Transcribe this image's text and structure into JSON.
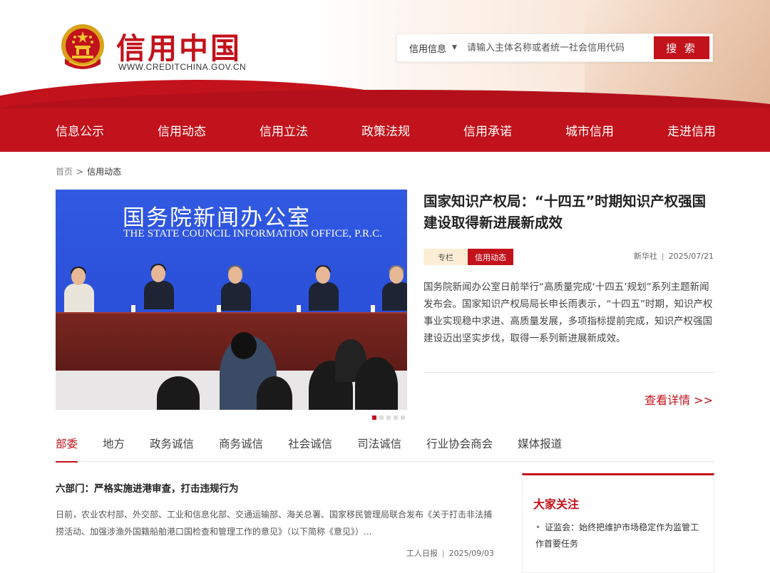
{
  "header": {
    "site_title": "信用中国",
    "site_url": "WWW.CREDITCHINA.GOV.CN",
    "brand_color": "#c2121b"
  },
  "search": {
    "category": "信用信息",
    "placeholder": "请输入主体名称或者统一社会信用代码",
    "button_label": "搜 索"
  },
  "nav": {
    "items": [
      "信息公示",
      "信用动态",
      "信用立法",
      "政策法规",
      "信用承诺",
      "城市信用",
      "走进信用"
    ]
  },
  "breadcrumb": {
    "home": "首页",
    "separator": ">",
    "current": "信用动态"
  },
  "feature": {
    "image": {
      "banner_cn": "国务院新闻办公室",
      "banner_en": "THE STATE COUNCIL INFORMATION OFFICE, P.R.C."
    },
    "title": "国家知识产权局：“十四五”时期知识产权强国建设取得新进展新成效",
    "tag_column": "专栏",
    "tag_category": "信用动态",
    "source": "新华社",
    "date": "2025/07/21",
    "summary": "国务院新闻办公室日前举行“高质量完成‘十四五’规划”系列主题新闻发布会。国家知识产权局局长申长雨表示，“十四五”时期，知识产权事业实现稳中求进、高质量发展，多项指标提前完成，知识产权强国建设迈出坚实步伐，取得一系列新进展新成效。",
    "more_label": "查看详情 >>",
    "carousel_count": 5,
    "carousel_active": 1
  },
  "tabs": {
    "items": [
      "部委",
      "地方",
      "政务诚信",
      "商务诚信",
      "社会诚信",
      "司法诚信",
      "行业协会商会",
      "媒体报道"
    ],
    "active": 0
  },
  "news": {
    "title": "六部门：严格实施进港审查，打击违规行为",
    "desc": "日前，农业农村部、外交部、工业和信息化部、交通运输部、海关总署、国家移民管理局联合发布《关于打击非法捕捞活动、加强涉渔外国籍船舶港口国检查和管理工作的意见》（以下简称《意见》）...",
    "source": "工人日报",
    "date": "2025/09/03"
  },
  "sidebar": {
    "title": "大家关注",
    "items": [
      "证监会：始终把维护市场稳定作为监管工作首要任务"
    ]
  }
}
